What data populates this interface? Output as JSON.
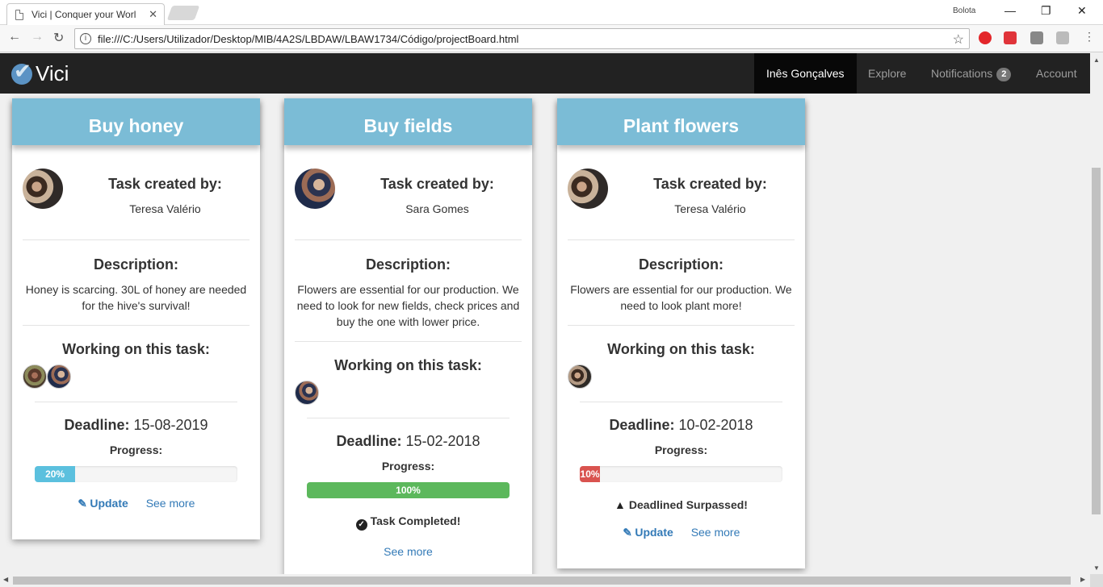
{
  "browser": {
    "tab_title": "Vici | Conquer your Worl",
    "tab_close": "✕",
    "profile": "Bolota",
    "url": "file:///C:/Users/Utilizador/Desktop/MIB/4A2S/LBDAW/LBAW1734/Código/projectBoard.html"
  },
  "navbar": {
    "brand": "Vici",
    "user": "Inês Gonçalves",
    "explore": "Explore",
    "notifications": "Notifications",
    "notifications_count": "2",
    "account": "Account"
  },
  "labels": {
    "created_by": "Task created by:",
    "description": "Description:",
    "working": "Working on this task:",
    "deadline": "Deadline:",
    "progress": "Progress:",
    "update": "Update",
    "see_more": "See more"
  },
  "cards": [
    {
      "title": "Buy honey",
      "creator": "Teresa Valério",
      "description": "Honey is scarcing. 30L of honey are needed for the hive's survival!",
      "deadline": "15-08-2019",
      "progress": 20,
      "progress_label": "20%",
      "progress_color": "#5bc0de"
    },
    {
      "title": "Buy fields",
      "creator": "Sara Gomes",
      "description": "Flowers are essential for our production. We need to look for new fields, check prices and buy the one with lower price.",
      "deadline": "15-02-2018",
      "progress": 100,
      "progress_label": "100%",
      "progress_color": "#5cb85c",
      "status": "Task Completed!"
    },
    {
      "title": "Plant flowers",
      "creator": "Teresa Valério",
      "description": "Flowers are essential for our production. We need to look plant more!",
      "deadline": "10-02-2018",
      "progress": 10,
      "progress_label": "10%",
      "progress_color": "#d9534f",
      "status": "Deadlined Surpassed!"
    }
  ],
  "colors": {
    "card_header": "#7bbcd6",
    "navbar": "#222222",
    "link": "#337ab7"
  }
}
